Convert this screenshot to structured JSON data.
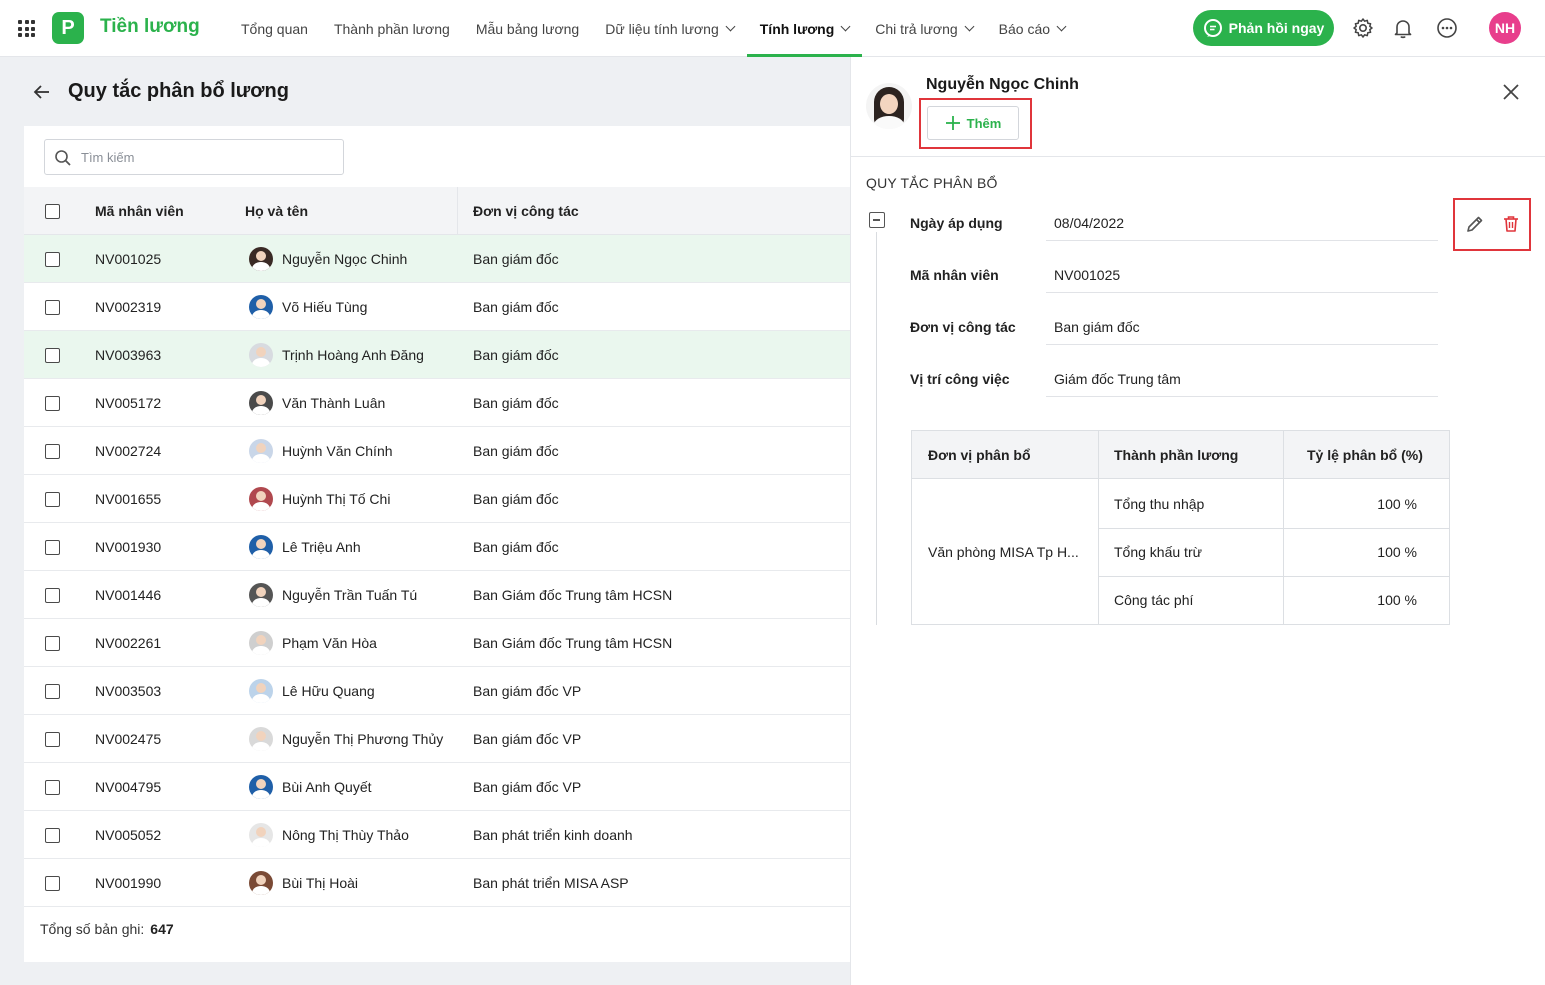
{
  "app": {
    "name": "Tiền lương",
    "logo_letter": "P",
    "brand_color": "#2bb24c"
  },
  "nav": [
    {
      "label": "Tổng quan",
      "dropdown": false,
      "active": false
    },
    {
      "label": "Thành phần lương",
      "dropdown": false,
      "active": false
    },
    {
      "label": "Mẫu bảng lương",
      "dropdown": false,
      "active": false
    },
    {
      "label": "Dữ liệu tính lương",
      "dropdown": true,
      "active": false
    },
    {
      "label": "Tính lương",
      "dropdown": true,
      "active": true
    },
    {
      "label": "Chi trả lương",
      "dropdown": true,
      "active": false
    },
    {
      "label": "Báo cáo",
      "dropdown": true,
      "active": false
    }
  ],
  "topbar": {
    "feedback_label": "Phản hồi ngay",
    "user_initials": "NH",
    "user_color": "#e83e8c"
  },
  "page": {
    "title": "Quy tắc phân bổ lương"
  },
  "search": {
    "placeholder": "Tìm kiếm"
  },
  "table": {
    "columns": [
      "Mã nhân viên",
      "Họ và tên",
      "Đơn vị công tác"
    ],
    "rows": [
      {
        "code": "NV001025",
        "name": "Nguyễn Ngọc Chinh",
        "unit": "Ban giám đốc",
        "highlight": true,
        "avatar": "#3a2a25"
      },
      {
        "code": "NV002319",
        "name": "Võ Hiếu Tùng",
        "unit": "Ban giám đốc",
        "highlight": false,
        "avatar": "#1f5fa8"
      },
      {
        "code": "NV003963",
        "name": "Trịnh Hoàng Anh Đăng",
        "unit": "Ban giám đốc",
        "highlight": true,
        "avatar": "#d8dbe0"
      },
      {
        "code": "NV005172",
        "name": "Văn Thành Luân",
        "unit": "Ban giám đốc",
        "highlight": false,
        "avatar": "#4a4a4a"
      },
      {
        "code": "NV002724",
        "name": "Huỳnh Văn Chính",
        "unit": "Ban giám đốc",
        "highlight": false,
        "avatar": "#c9d6e8"
      },
      {
        "code": "NV001655",
        "name": "Huỳnh Thị Tố Chi",
        "unit": "Ban giám đốc",
        "highlight": false,
        "avatar": "#b0484e"
      },
      {
        "code": "NV001930",
        "name": "Lê Triệu Anh",
        "unit": "Ban giám đốc",
        "highlight": false,
        "avatar": "#1f5fa8"
      },
      {
        "code": "NV001446",
        "name": "Nguyễn Trần Tuấn Tú",
        "unit": "Ban Giám đốc Trung tâm HCSN",
        "highlight": false,
        "avatar": "#555555"
      },
      {
        "code": "NV002261",
        "name": "Phạm Văn Hòa",
        "unit": "Ban Giám đốc Trung tâm HCSN",
        "highlight": false,
        "avatar": "#cfcfcf"
      },
      {
        "code": "NV003503",
        "name": "Lê Hữu Quang",
        "unit": "Ban giám đốc VP",
        "highlight": false,
        "avatar": "#bcd3ea"
      },
      {
        "code": "NV002475",
        "name": "Nguyễn Thị Phương Thủy",
        "unit": "Ban giám đốc VP",
        "highlight": false,
        "avatar": "#d9d9d9"
      },
      {
        "code": "NV004795",
        "name": "Bùi Anh Quyết",
        "unit": "Ban giám đốc VP",
        "highlight": false,
        "avatar": "#1f5fa8"
      },
      {
        "code": "NV005052",
        "name": "Nông Thị Thùy Thảo",
        "unit": "Ban phát triển kinh doanh",
        "highlight": false,
        "avatar": "#e6e6e6"
      },
      {
        "code": "NV001990",
        "name": "Bùi Thị Hoài",
        "unit": "Ban phát triển MISA ASP",
        "highlight": false,
        "avatar": "#7a4a35"
      }
    ]
  },
  "footer": {
    "label": "Tổng số bản ghi:",
    "count": "647"
  },
  "detail": {
    "name": "Nguyễn Ngọc Chinh",
    "add_label": "Thêm",
    "section_title": "QUY TẮC PHÂN BỔ",
    "fields": [
      {
        "label": "Ngày áp dụng",
        "value": "08/04/2022"
      },
      {
        "label": "Mã nhân viên",
        "value": "NV001025"
      },
      {
        "label": "Đơn vị công tác",
        "value": "Ban giám đốc"
      },
      {
        "label": "Vị trí công việc",
        "value": "Giám đốc Trung tâm"
      }
    ],
    "alloc_table": {
      "headers": [
        "Đơn vị phân bổ",
        "Thành phần lương",
        "Tỷ lệ phân bổ (%)"
      ],
      "unit": "Văn phòng MISA Tp H...",
      "rows": [
        {
          "component": "Tổng thu nhập",
          "ratio": "100 %"
        },
        {
          "component": "Tổng khấu trừ",
          "ratio": "100 %"
        },
        {
          "component": "Công tác phí",
          "ratio": "100 %"
        }
      ]
    }
  }
}
